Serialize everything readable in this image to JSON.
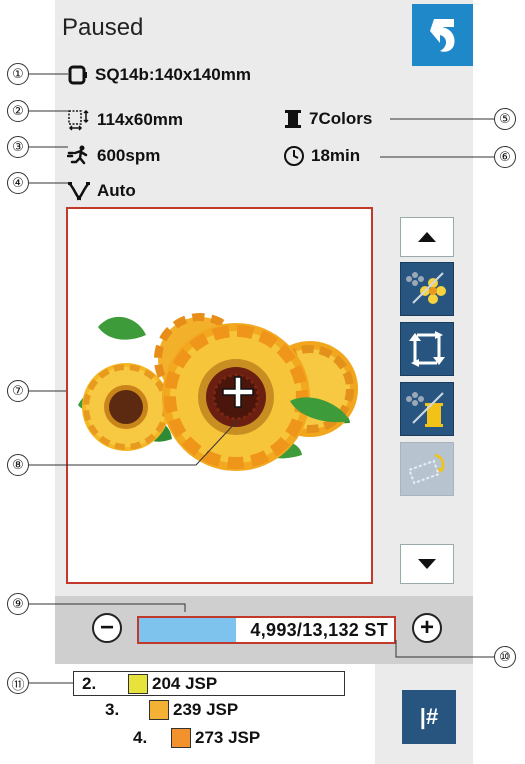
{
  "header": {
    "status": "Paused"
  },
  "info": {
    "hoop": "SQ14b:140x140mm",
    "size": "114x60mm",
    "colors": "7Colors",
    "speed": "600spm",
    "time": "18min",
    "tension": "Auto"
  },
  "progress": {
    "text": "4,993/13,132 ST",
    "fraction": 0.38
  },
  "color_list": [
    {
      "number": "2.",
      "code": "204 JSP",
      "color": "#e8e23c"
    },
    {
      "number": "3.",
      "code": "239 JSP",
      "color": "#f3b234"
    },
    {
      "number": "4.",
      "code": "273 JSP",
      "color": "#f2922c"
    }
  ],
  "callouts": [
    "①",
    "②",
    "③",
    "④",
    "⑤",
    "⑥",
    "⑦",
    "⑧",
    "⑨",
    "⑩",
    "⑪"
  ],
  "needle_button": {
    "label": "|#"
  },
  "accent": "#1e88c8"
}
